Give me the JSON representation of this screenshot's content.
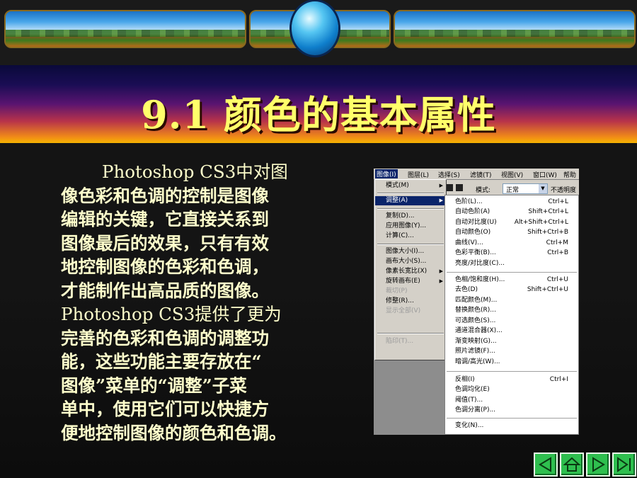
{
  "slide": {
    "title": "9.1 颜色的基本属性",
    "body_lines": [
      "Photoshop CS3中对图",
      "像色彩和色调的控制是图像",
      "编辑的关键，它直接关系到",
      "图像最后的效果，只有有效",
      "地控制图像的色彩和色调，",
      "才能制作出高品质的图像。",
      "Photoshop CS3提供了更为",
      "完善的色彩和色调的调整功",
      "能，这些功能主要存放在“",
      "图像”菜单的“调整”子菜",
      "单中，使用它们可以快捷方",
      "便地控制图像的颜色和色调。"
    ]
  },
  "screenshot": {
    "menubar": [
      "图像(I)",
      "图层(L)",
      "选择(S)",
      "滤镜(T)",
      "视图(V)",
      "窗口(W)",
      "帮助"
    ],
    "options": {
      "mode_label": "模式:",
      "mode_value": "正常",
      "opacity_label": "不透明度"
    },
    "image_menu": [
      {
        "label": "模式(M)",
        "submenu": true
      },
      {
        "label": "调整(A)",
        "submenu": true,
        "highlighted": true
      },
      {
        "label": "复制(D)..."
      },
      {
        "label": "应用图像(Y)..."
      },
      {
        "label": "计算(C)..."
      },
      {
        "label": "图像大小(I)..."
      },
      {
        "label": "画布大小(S)..."
      },
      {
        "label": "像素长宽比(X)",
        "submenu": true
      },
      {
        "label": "旋转画布(E)",
        "submenu": true
      },
      {
        "label": "裁切(P)",
        "disabled": true
      },
      {
        "label": "修整(R)..."
      },
      {
        "label": "显示全部(V)",
        "disabled": true
      },
      {
        "label": "陷印(T)...",
        "disabled": true
      }
    ],
    "adjust_menu": [
      {
        "label": "色阶(L)...",
        "shortcut": "Ctrl+L"
      },
      {
        "label": "自动色阶(A)",
        "shortcut": "Shift+Ctrl+L"
      },
      {
        "label": "自动对比度(U)",
        "shortcut": "Alt+Shift+Ctrl+L"
      },
      {
        "label": "自动颜色(O)",
        "shortcut": "Shift+Ctrl+B"
      },
      {
        "label": "曲线(V)...",
        "shortcut": "Ctrl+M"
      },
      {
        "label": "色彩平衡(B)...",
        "shortcut": "Ctrl+B"
      },
      {
        "label": "亮度/对比度(C)...",
        "shortcut": ""
      },
      {
        "label": "色相/饱和度(H)...",
        "shortcut": "Ctrl+U"
      },
      {
        "label": "去色(D)",
        "shortcut": "Shift+Ctrl+U"
      },
      {
        "label": "匹配颜色(M)...",
        "shortcut": ""
      },
      {
        "label": "替换颜色(R)...",
        "shortcut": ""
      },
      {
        "label": "可选颜色(S)...",
        "shortcut": ""
      },
      {
        "label": "通道混合器(X)...",
        "shortcut": ""
      },
      {
        "label": "渐变映射(G)...",
        "shortcut": ""
      },
      {
        "label": "照片滤镜(F)...",
        "shortcut": ""
      },
      {
        "label": "暗调/高光(W)...",
        "shortcut": ""
      },
      {
        "label": "反相(I)",
        "shortcut": "Ctrl+I"
      },
      {
        "label": "色调均化(E)",
        "shortcut": ""
      },
      {
        "label": "阈值(T)...",
        "shortcut": ""
      },
      {
        "label": "色调分离(P)...",
        "shortcut": ""
      },
      {
        "label": "变化(N)...",
        "shortcut": ""
      }
    ]
  },
  "nav": {
    "buttons": [
      "prev-icon",
      "home-icon",
      "next-icon",
      "last-icon"
    ],
    "color": "#2fbf4f"
  }
}
